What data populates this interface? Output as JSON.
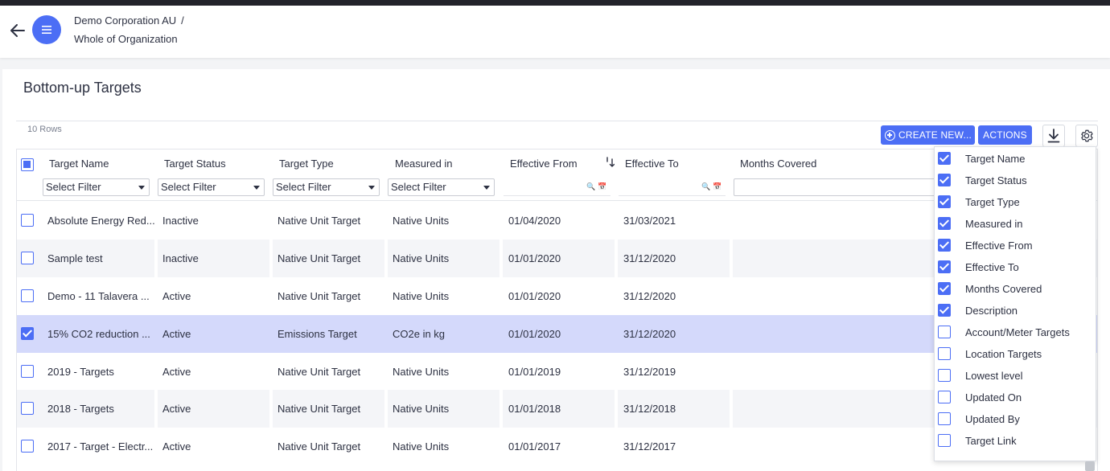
{
  "breadcrumb": {
    "org": "Demo Corporation AU",
    "separator": "/",
    "scope": "Whole of Organization"
  },
  "page": {
    "title": "Bottom-up Targets",
    "row_count": "10 Rows"
  },
  "toolbar": {
    "create_label": "CREATE NEW...",
    "actions_label": "ACTIONS",
    "download_icon": "download-icon",
    "settings_icon": "gear-icon"
  },
  "columns": [
    "Target Name",
    "Target Status",
    "Target Type",
    "Measured in",
    "Effective From",
    "Effective To",
    "Months Covered"
  ],
  "filters": {
    "select_placeholder": "Select Filter"
  },
  "rows": [
    {
      "name": "Absolute Energy Red...",
      "status": "Inactive",
      "type": "Native Unit Target",
      "measured": "Native Units",
      "from": "01/04/2020",
      "to": "31/03/2021",
      "checked": false
    },
    {
      "name": "Sample test",
      "status": "Inactive",
      "type": "Native Unit Target",
      "measured": "Native Units",
      "from": "01/01/2020",
      "to": "31/12/2020",
      "checked": false
    },
    {
      "name": "Demo - 11 Talavera ...",
      "status": "Active",
      "type": "Native Unit Target",
      "measured": "Native Units",
      "from": "01/01/2020",
      "to": "31/12/2020",
      "checked": false
    },
    {
      "name": "15% CO2 reduction ...",
      "status": "Active",
      "type": "Emissions Target",
      "measured": "CO2e in kg",
      "from": "01/01/2020",
      "to": "31/12/2020",
      "checked": true
    },
    {
      "name": "2019 - Targets",
      "status": "Active",
      "type": "Native Unit Target",
      "measured": "Native Units",
      "from": "01/01/2019",
      "to": "31/12/2019",
      "checked": false
    },
    {
      "name": "2018 - Targets",
      "status": "Active",
      "type": "Native Unit Target",
      "measured": "Native Units",
      "from": "01/01/2018",
      "to": "31/12/2018",
      "checked": false
    },
    {
      "name": "2017 - Target - Electr...",
      "status": "Active",
      "type": "Native Unit Target",
      "measured": "Native Units",
      "from": "01/01/2017",
      "to": "31/12/2017",
      "checked": false
    }
  ],
  "column_chooser": [
    {
      "label": "Target Name",
      "checked": true
    },
    {
      "label": "Target Status",
      "checked": true
    },
    {
      "label": "Target Type",
      "checked": true
    },
    {
      "label": "Measured in",
      "checked": true
    },
    {
      "label": "Effective From",
      "checked": true
    },
    {
      "label": "Effective To",
      "checked": true
    },
    {
      "label": "Months Covered",
      "checked": true
    },
    {
      "label": "Description",
      "checked": true
    },
    {
      "label": "Account/Meter Targets",
      "checked": false
    },
    {
      "label": "Location Targets",
      "checked": false
    },
    {
      "label": "Lowest level",
      "checked": false
    },
    {
      "label": "Updated On",
      "checked": false
    },
    {
      "label": "Updated By",
      "checked": false
    },
    {
      "label": "Target Link",
      "checked": false
    }
  ],
  "colors": {
    "accent": "#4c6ef5",
    "selected_row": "#d4d9fb",
    "alt_row": "#f4f5f8"
  }
}
